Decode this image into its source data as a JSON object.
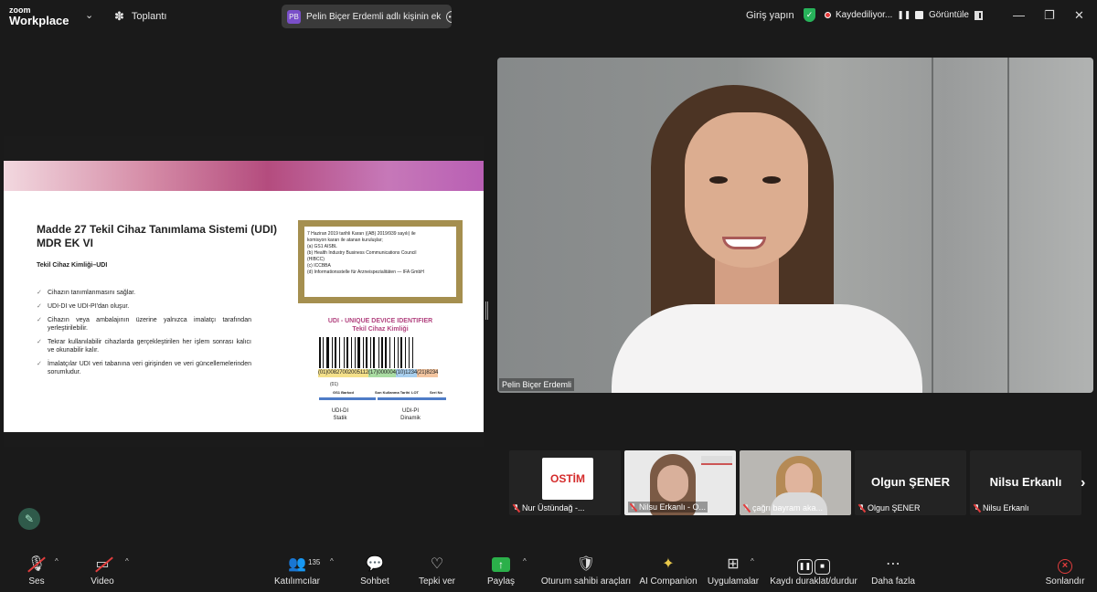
{
  "topbar": {
    "logo_top": "zoom",
    "logo_bottom": "Workplace",
    "meeting_label": "Toplantı",
    "share_initials": "PB",
    "share_text": "Pelin Biçer Erdemli adlı kişinin ek",
    "sign_in": "Giriş yapın",
    "recording_text": "Kaydediliyor...",
    "view_label": "Görüntüle",
    "minimize": "—",
    "restore": "❐",
    "close": "✕"
  },
  "slide": {
    "title": "Madde 27 Tekil Cihaz Tanımlama Sistemi (UDI) MDR EK VI",
    "subtitle": "Tekil Cihaz Kimliği–UDI",
    "bullets": [
      "Cihazın tanımlanmasını sağlar.",
      "UDI-DI ve UDI-PI'dan oluşur.",
      "Cihazın veya ambalajının üzerine yalnızca imalatçı tarafından yerleştirilebilir.",
      "Tekrar kullanılabilir cihazlarda gerçekleştirilen her işlem sonrası kalıcı ve okunabilir kalır.",
      "İmalatçılar UDI veri tabanına veri girişinden ve veri güncellemelerinden sorumludur."
    ],
    "gold_box_lines": [
      "7 Haziran 2019 tarihli Kararı ((AB) 2019/939 sayılı) ile",
      "komisyon kararı ile atanan kuruluşlar;",
      "(a) GS1 AISBL",
      "(b) Health Industry Business Communications Council",
      "(HIBCC)",
      "(c) ICCBBA",
      "(d) Informationsstelle für Arzneispezialitäten — IFA GmbH"
    ],
    "udi_title_1": "UDI - UNIQUE DEVICE IDENTIFIER",
    "udi_title_2": "Tekil Cihaz Kimliği",
    "udi_segments": [
      "(01)00827002005112",
      "(17)000004",
      "(10)1234",
      "(21)8234"
    ],
    "udi_code": "(01)",
    "udi_labels": [
      "GS1 Barkod",
      "Son Kullanma Tarihi",
      "LOT",
      "Seri No"
    ],
    "udi_di": [
      "UDI-DI",
      "Statik"
    ],
    "udi_pi": [
      "UDI-PI",
      "Dinamik"
    ]
  },
  "speaker": {
    "name": "Pelin Biçer Erdemli"
  },
  "thumbnails": [
    {
      "name": "Nur Üstündağ -...",
      "logo_text": "OSTİM"
    },
    {
      "name": "Nilsu Erkanlı - O..."
    },
    {
      "name": "çağrı bayram aka..."
    },
    {
      "name": "Olgun ŞENER",
      "big": "Olgun ŞENER"
    },
    {
      "name": "Nilsu Erkanlı",
      "big": "Nilsu Erkanlı"
    }
  ],
  "toolbar": {
    "audio": "Ses",
    "video": "Video",
    "participants": "Katılımcılar",
    "participants_count": "135",
    "chat": "Sohbet",
    "react": "Tepki ver",
    "share": "Paylaş",
    "host_tools": "Oturum sahibi araçları",
    "ai_companion": "AI Companion",
    "apps": "Uygulamalar",
    "record": "Kaydı duraklat/durdur",
    "more": "Daha fazla",
    "end": "Sonlandır"
  },
  "colors": {
    "accent_green": "#2bb04a",
    "recording_red": "#e43b3b",
    "udi_pink": "#b2437f"
  }
}
